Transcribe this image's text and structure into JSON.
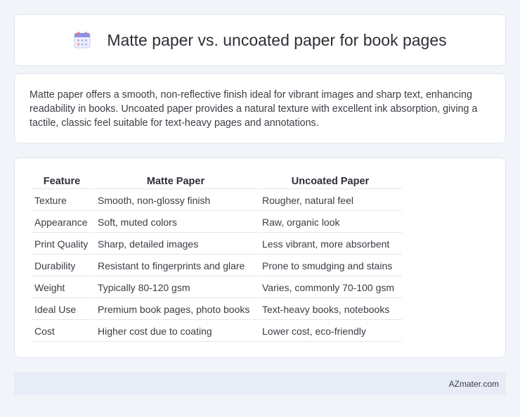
{
  "header": {
    "title": "Matte paper vs. uncoated paper for book pages",
    "icon": "calendar-icon"
  },
  "description": "Matte paper offers a smooth, non-reflective finish ideal for vibrant images and sharp text, enhancing readability in books. Uncoated paper provides a natural texture with excellent ink absorption, giving a tactile, classic feel suitable for text-heavy pages and annotations.",
  "table": {
    "headers": [
      "Feature",
      "Matte Paper",
      "Uncoated Paper"
    ],
    "rows": [
      [
        "Texture",
        "Smooth, non-glossy finish",
        "Rougher, natural feel"
      ],
      [
        "Appearance",
        "Soft, muted colors",
        "Raw, organic look"
      ],
      [
        "Print Quality",
        "Sharp, detailed images",
        "Less vibrant, more absorbent"
      ],
      [
        "Durability",
        "Resistant to fingerprints and glare",
        "Prone to smudging and stains"
      ],
      [
        "Weight",
        "Typically 80-120 gsm",
        "Varies, commonly 70-100 gsm"
      ],
      [
        "Ideal Use",
        "Premium book pages, photo books",
        "Text-heavy books, notebooks"
      ],
      [
        "Cost",
        "Higher cost due to coating",
        "Lower cost, eco-friendly"
      ]
    ]
  },
  "footer": {
    "site": "AZmater.com"
  }
}
